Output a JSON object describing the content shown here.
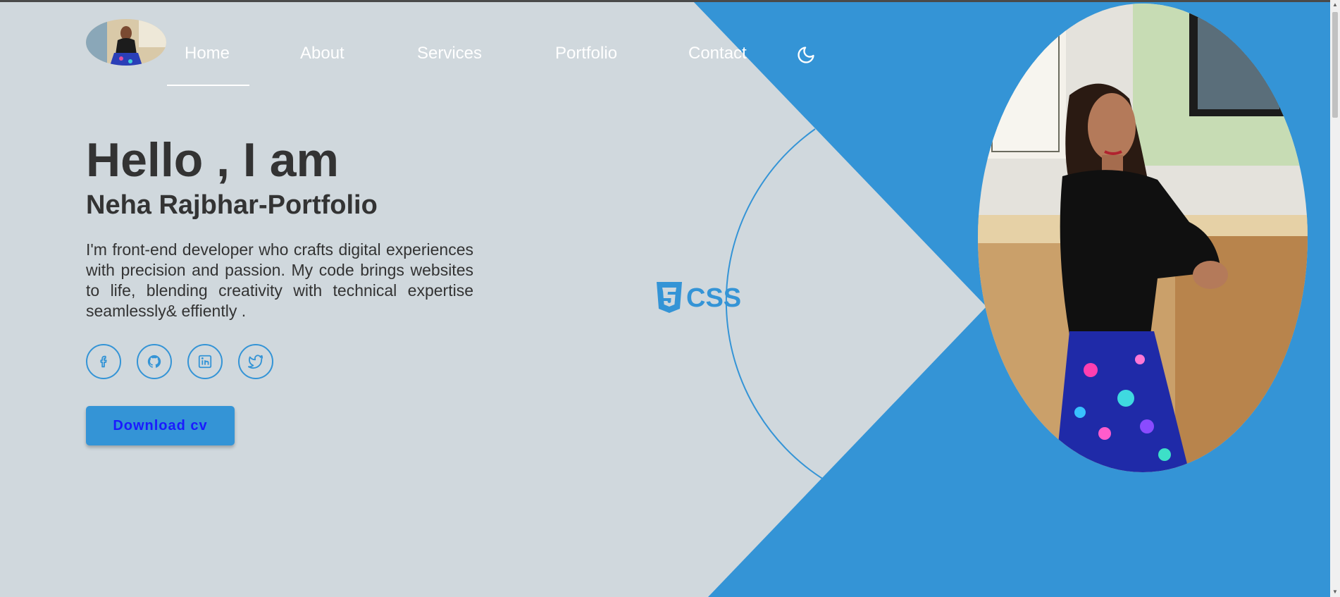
{
  "nav": {
    "items": [
      {
        "label": "Home"
      },
      {
        "label": "About"
      },
      {
        "label": "Services"
      },
      {
        "label": "Portfolio"
      },
      {
        "label": "Contact"
      }
    ],
    "active": "Home",
    "theme_toggle_icon": "moon-icon"
  },
  "hero": {
    "greeting": "Hello , I am",
    "name": "Neha Rajbhar-Portfolio",
    "description": "I'm front-end developer who crafts digital experiences with precision and passion. My code brings websites to life, blending creativity with technical expertise seamlessly& effiently .",
    "cv_button": "Download cv",
    "social": [
      "facebook-icon",
      "github-icon",
      "linkedin-icon",
      "twitter-icon"
    ]
  },
  "skill_badge": {
    "icon": "css3-icon",
    "label": "CSS"
  },
  "colors": {
    "background": "#d0d8dd",
    "accent": "#3494d6",
    "text": "#333333",
    "nav_text": "#ffffff",
    "button_text": "#1a1aff"
  }
}
